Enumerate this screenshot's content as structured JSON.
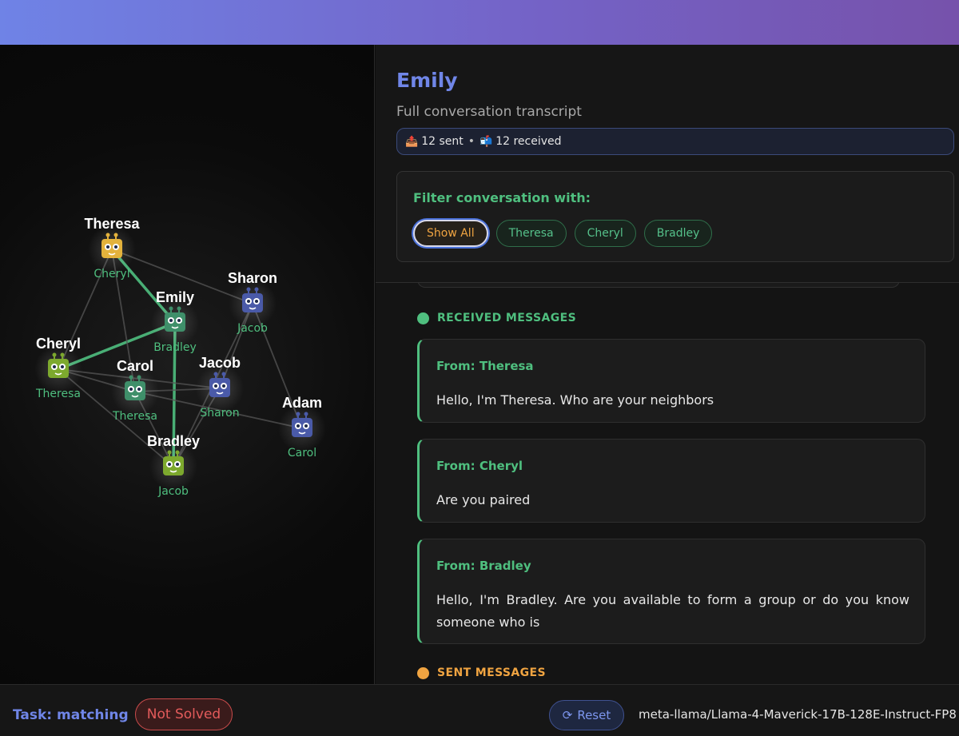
{
  "graph": {
    "nodes": [
      {
        "id": "Theresa",
        "name": "Theresa",
        "partner": "Cheryl",
        "color": "#e3b23c"
      },
      {
        "id": "Emily",
        "name": "Emily",
        "partner": "Bradley",
        "color": "#3f8f6a"
      },
      {
        "id": "Sharon",
        "name": "Sharon",
        "partner": "Jacob",
        "color": "#4a5aa8"
      },
      {
        "id": "Cheryl",
        "name": "Cheryl",
        "partner": "Theresa",
        "color": "#7da92e"
      },
      {
        "id": "Carol",
        "name": "Carol",
        "partner": "Theresa",
        "color": "#3f8f6a"
      },
      {
        "id": "Jacob",
        "name": "Jacob",
        "partner": "Sharon",
        "color": "#4a5aa8"
      },
      {
        "id": "Adam",
        "name": "Adam",
        "partner": "Carol",
        "color": "#4a5aa8"
      },
      {
        "id": "Bradley",
        "name": "Bradley",
        "partner": "Jacob",
        "color": "#7da92e"
      }
    ],
    "edges": [
      {
        "from": "Theresa",
        "to": "Emily",
        "highlight": true
      },
      {
        "from": "Cheryl",
        "to": "Emily",
        "highlight": true
      },
      {
        "from": "Emily",
        "to": "Bradley",
        "highlight": true
      },
      {
        "from": "Theresa",
        "to": "Cheryl",
        "highlight": false
      },
      {
        "from": "Theresa",
        "to": "Carol",
        "highlight": false
      },
      {
        "from": "Theresa",
        "to": "Sharon",
        "highlight": false
      },
      {
        "from": "Sharon",
        "to": "Jacob",
        "highlight": false
      },
      {
        "from": "Sharon",
        "to": "Adam",
        "highlight": false
      },
      {
        "from": "Sharon",
        "to": "Bradley",
        "highlight": false
      },
      {
        "from": "Cheryl",
        "to": "Carol",
        "highlight": false
      },
      {
        "from": "Cheryl",
        "to": "Jacob",
        "highlight": false
      },
      {
        "from": "Cheryl",
        "to": "Bradley",
        "highlight": false
      },
      {
        "from": "Carol",
        "to": "Jacob",
        "highlight": false
      },
      {
        "from": "Carol",
        "to": "Adam",
        "highlight": false
      },
      {
        "from": "Carol",
        "to": "Bradley",
        "highlight": false
      },
      {
        "from": "Jacob",
        "to": "Bradley",
        "highlight": false
      }
    ],
    "colors": {
      "edge": "#555555",
      "highlight_edge": "#4fbf7f",
      "partner_text": "#4fbf7f"
    }
  },
  "detail": {
    "title": "Emily",
    "subtitle": "Full conversation transcript",
    "sent_icon": "📤",
    "sent_text": "12 sent",
    "separator": "•",
    "received_icon": "📬",
    "received_text": "12 received",
    "filter_title": "Filter conversation with:",
    "filters": [
      "Show All",
      "Theresa",
      "Cheryl",
      "Bradley"
    ],
    "active_filter": "Show All",
    "received_heading": "RECEIVED MESSAGES",
    "sent_heading": "SENT MESSAGES",
    "received_messages": [
      {
        "from": "From: Theresa",
        "text": "Hello, I'm Theresa. Who are your neighbors"
      },
      {
        "from": "From: Cheryl",
        "text": "Are you paired"
      },
      {
        "from": "From: Bradley",
        "text": "Hello, I'm Bradley. Are you available to form a group or do you know someone who is"
      }
    ]
  },
  "footer": {
    "task_label": "Task: matching",
    "status": "Not Solved",
    "reset_icon": "⟳",
    "reset_label": "Reset",
    "model": "meta-llama/Llama-4-Maverick-17B-128E-Instruct-FP8"
  }
}
